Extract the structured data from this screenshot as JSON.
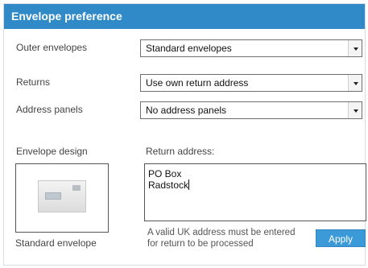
{
  "panel": {
    "title": "Envelope preference"
  },
  "rows": [
    {
      "label": "Outer envelopes",
      "value": "Standard envelopes"
    },
    {
      "label": "Returns",
      "value": "Use own return address"
    },
    {
      "label": "Address panels",
      "value": "No address panels"
    }
  ],
  "design": {
    "heading": "Envelope design",
    "caption": "Standard envelope"
  },
  "return_address": {
    "heading": "Return address:",
    "lines": [
      "PO Box",
      "Radstock"
    ],
    "note": "A valid UK address must be entered for return to be processed"
  },
  "buttons": {
    "apply": "Apply"
  },
  "colors": {
    "header": "#2f8ac7",
    "button": "#3d9ad8"
  },
  "icons": {
    "dropdown": "chevron-down-icon",
    "design_preview": "envelope-icon"
  }
}
